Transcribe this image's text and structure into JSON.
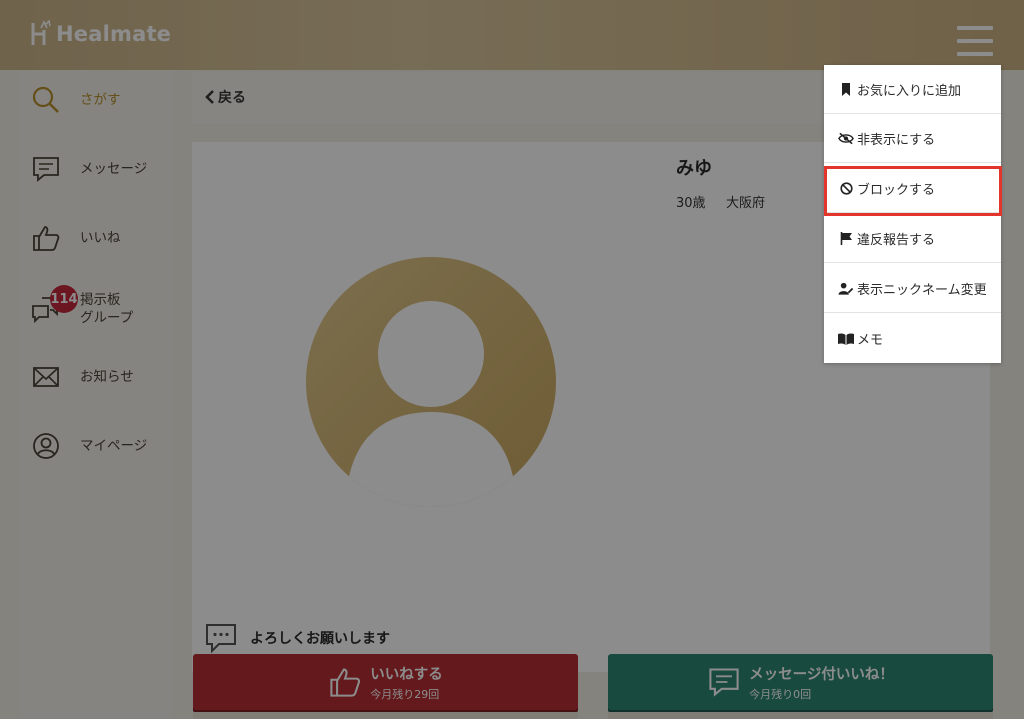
{
  "header": {
    "logo_text": "Healmate",
    "menu_icon": "hamburger-icon"
  },
  "sidebar": {
    "items": [
      {
        "label": "さがす",
        "icon": "search-icon"
      },
      {
        "label": "メッセージ",
        "icon": "message-icon"
      },
      {
        "label": "いいね",
        "icon": "thumbs-up-icon"
      },
      {
        "label": "掲示板\nグループ",
        "icon": "chat-bubbles-icon",
        "badge": "114"
      },
      {
        "label": "お知らせ",
        "icon": "envelope-icon"
      },
      {
        "label": "マイページ",
        "icon": "user-circle-icon"
      }
    ]
  },
  "back": {
    "label": "戻る"
  },
  "profile": {
    "name": "みゆ",
    "age": "30歳",
    "prefecture": "大阪府",
    "greeting": "よろしくお願いします"
  },
  "actions": {
    "like": {
      "label": "いいねする",
      "sub": "今月残り29回"
    },
    "message_like": {
      "label": "メッセージ付いいね！",
      "sub": "今月残り0回"
    }
  },
  "menu": {
    "items": [
      {
        "label": "お気に入りに追加",
        "icon": "bookmark-icon"
      },
      {
        "label": "非表示にする",
        "icon": "eye-slash-icon"
      },
      {
        "label": "ブロックする",
        "icon": "ban-icon"
      },
      {
        "label": "違反報告する",
        "icon": "flag-icon"
      },
      {
        "label": "表示ニックネーム変更",
        "icon": "user-edit-icon"
      },
      {
        "label": "メモ",
        "icon": "book-icon"
      }
    ],
    "highlighted_index": 2,
    "highlight_color": "#e3352b"
  },
  "colors": {
    "header_gold": "#d2bb8f",
    "like_red": "#b62f34",
    "message_green": "#2f8873",
    "badge_red": "#c4293b",
    "avatar_gold": "#d9b96e"
  }
}
